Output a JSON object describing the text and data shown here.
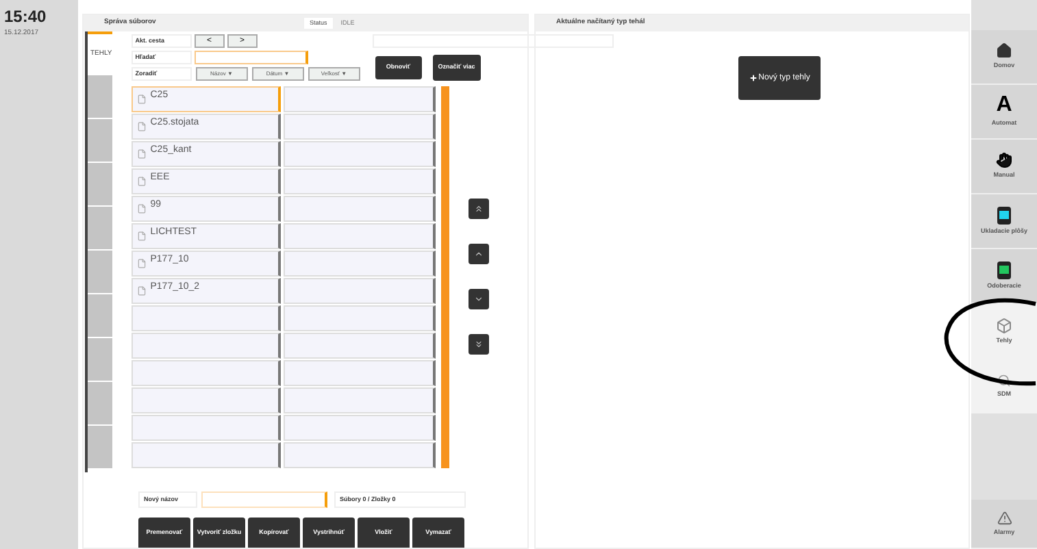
{
  "clock": {
    "time": "15:40",
    "date": "15.12.2017"
  },
  "file_panel": {
    "title": "Správa súborov",
    "status_label": "Status",
    "status_value": "IDLE",
    "tabs": [
      {
        "label": "TEHLY",
        "selected": true
      },
      {
        "selected": false
      },
      {
        "selected": false
      },
      {
        "selected": false
      },
      {
        "selected": false
      },
      {
        "selected": false
      },
      {
        "selected": false
      },
      {
        "selected": false
      },
      {
        "selected": false
      },
      {
        "selected": false
      }
    ],
    "path_label": "Akt. cesta",
    "back": "<",
    "forward": ">",
    "search_label": "Hľadať",
    "sort_label": "Zoradiť",
    "sort_buttons": [
      "Názov ▼",
      "Dátum ▼",
      "Veľkosť ▼"
    ],
    "refresh": "Obnoviť",
    "multi_select": "Označiť viac",
    "rows": [
      {
        "name": "C25",
        "selected": true
      },
      {
        "name": "C25.stojata",
        "selected": false
      },
      {
        "name": "C25_kant",
        "selected": false
      },
      {
        "name": "EEE",
        "selected": false
      },
      {
        "name": "99",
        "selected": false
      },
      {
        "name": "LICHTEST",
        "selected": false
      },
      {
        "name": "P177_10",
        "selected": false
      },
      {
        "name": "P177_10_2",
        "selected": false
      },
      {
        "selected": false
      },
      {
        "selected": false
      },
      {
        "selected": false
      },
      {
        "selected": false
      },
      {
        "selected": false
      },
      {
        "selected": false
      }
    ],
    "new_name_label": "Nový názov",
    "counts": "Súbory 0 / Zložky 0",
    "actions": [
      "Premenovať",
      "Vytvoriť zložku",
      "Kopírovať",
      "Vystrihnúť",
      "Vložiť",
      "Vymazať"
    ]
  },
  "type_panel": {
    "title": "Aktuálne načítaný typ tehál",
    "new_button": "Nový typ tehly"
  },
  "sidebar": [
    {
      "kind": "home",
      "label": "Domov",
      "selected": false
    },
    {
      "kind": "letter",
      "glyph": "A",
      "label": "Automat",
      "selected": false
    },
    {
      "kind": "hand",
      "label": "Manual",
      "selected": false
    },
    {
      "kind": "storage",
      "label": "Ukladacie plôšy",
      "selected": false
    },
    {
      "kind": "pickup",
      "label": "Odoberacie",
      "selected": false
    },
    {
      "kind": "brick",
      "label": "Tehly",
      "selected": true
    },
    {
      "kind": "search",
      "label": "SDM",
      "selected": true
    },
    {
      "kind": "alarm",
      "label": "Alarmy",
      "selected": false
    }
  ]
}
